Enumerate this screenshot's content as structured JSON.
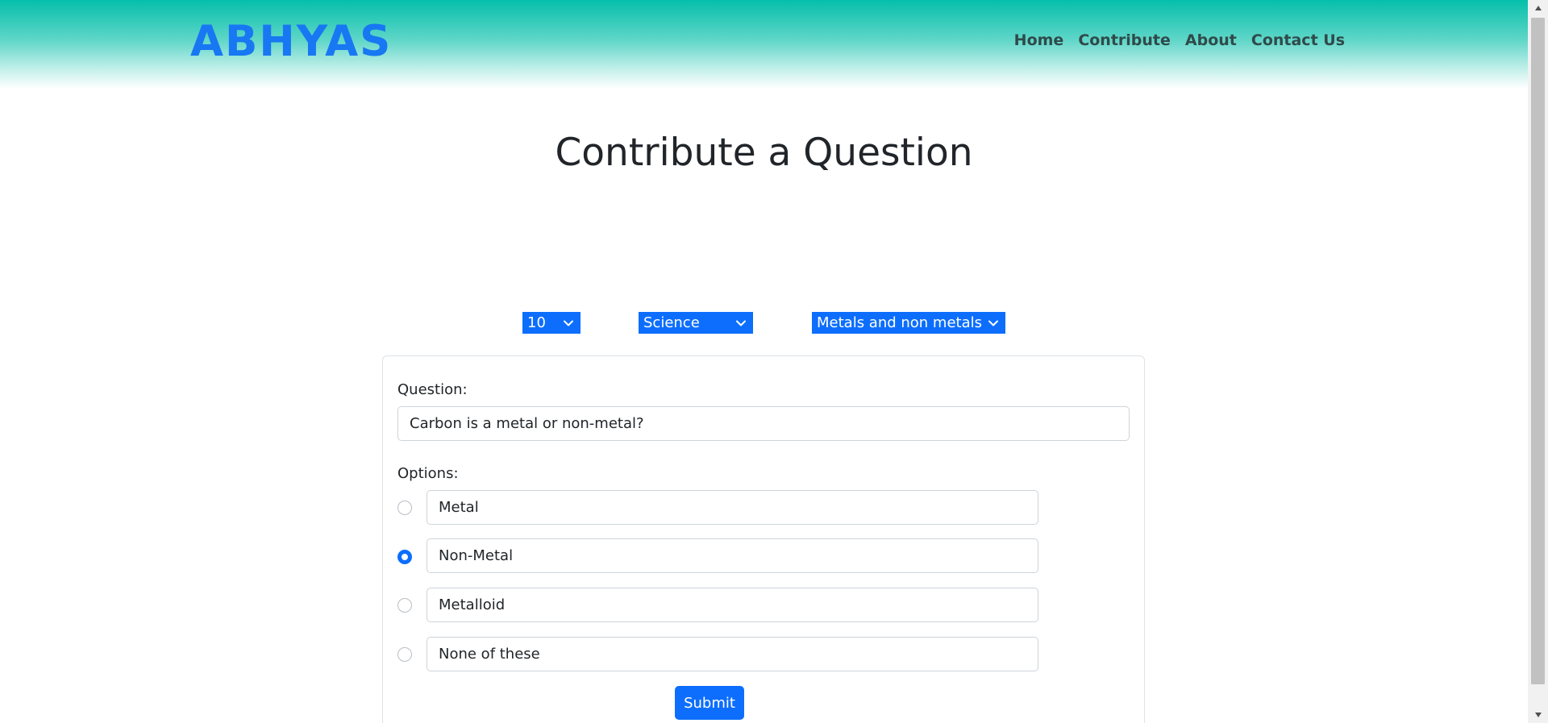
{
  "brand": "ABHYAS",
  "nav": {
    "home": "Home",
    "contribute": "Contribute",
    "about": "About",
    "contact": "Contact Us"
  },
  "page_title": "Contribute a Question",
  "selects": {
    "class": "10",
    "subject": "Science",
    "chapter": "Metals and non metals"
  },
  "form": {
    "question_label": "Question:",
    "question_value": "Carbon is a metal or non-metal?",
    "options_label": "Options:",
    "options": [
      {
        "value": "Metal",
        "selected": false
      },
      {
        "value": "Non-Metal",
        "selected": true
      },
      {
        "value": "Metalloid",
        "selected": false
      },
      {
        "value": "None of these",
        "selected": false
      }
    ],
    "submit_label": "Submit"
  },
  "colors": {
    "accent": "#0d6efd",
    "brand": "#1877f2",
    "header_top": "#05bfab"
  },
  "icons": {
    "select_chevron": "chevron-down-icon",
    "scroll_up": "triangle-up-icon",
    "scroll_down": "triangle-down-icon"
  }
}
